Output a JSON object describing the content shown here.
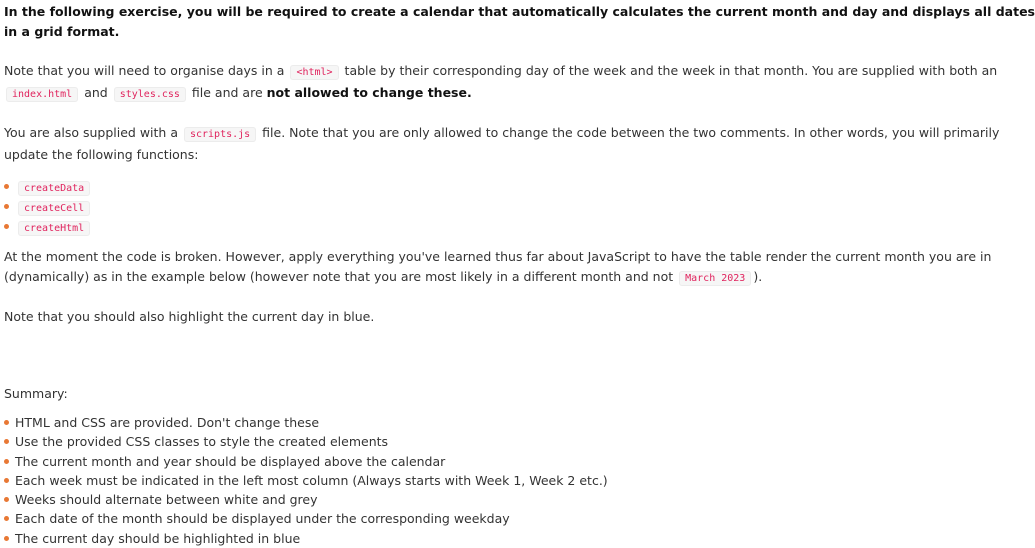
{
  "heading": "In the following exercise, you will be required to create a calendar that automatically calculates the current month and day and displays all dates in a grid format.",
  "para1": {
    "t1": "Note that you will need to organise days in a",
    "c1": "<html>",
    "t2": "table by their corresponding day of the week and the week in that month. You are supplied with both an",
    "c2": "index.html",
    "t3": "and",
    "c3": "styles.css",
    "t4": "file and are",
    "bold": "not allowed to change these."
  },
  "para2": {
    "t1": "You are also supplied with a",
    "c1": "scripts.js",
    "t2": "file. Note that you are only allowed to change the code between the two comments. In other words, you will primarily update the following functions:"
  },
  "functions": [
    "createData",
    "createCell",
    "createHtml"
  ],
  "para3": {
    "t1": "At the moment the code is broken. However, apply everything you've learned thus far about JavaScript to have the table render the current month you are in (dynamically) as in the example below (however note that you are most likely in a different month and not",
    "c1": "March 2023",
    "t2": ")."
  },
  "para4": "Note that you should also highlight the current day in blue.",
  "summary_label": "Summary:",
  "summary": [
    "HTML and CSS are provided. Don't change these",
    "Use the provided CSS classes to style the created elements",
    "The current month and year should be displayed above the calendar",
    "Each week must be indicated in the left most column (Always starts with Week 1, Week 2 etc.)",
    "Weeks should alternate between white and grey",
    "Each date of the month should be displayed under the corresponding weekday",
    "The current day should be highlighted in blue"
  ],
  "colors": {
    "bullet": "#e87834",
    "code_text": "#e0245e",
    "code_bg": "#f6f6f6"
  }
}
